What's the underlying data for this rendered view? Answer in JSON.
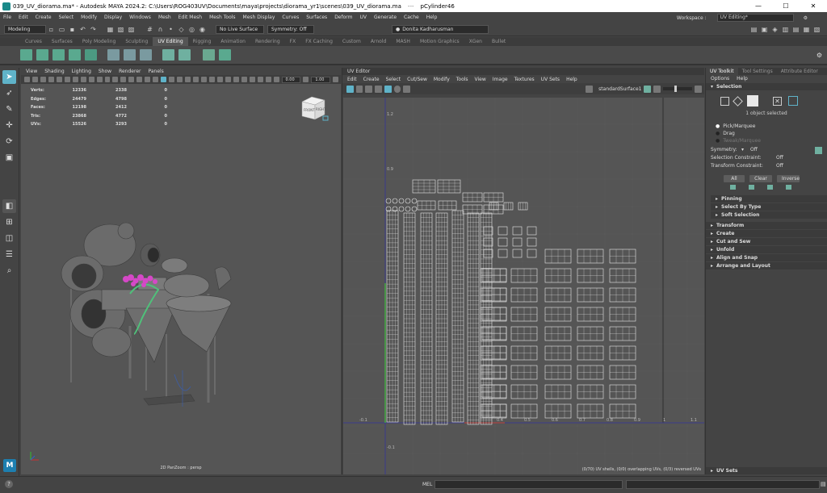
{
  "window": {
    "title": "039_UV_diorama.ma* - Autodesk MAYA 2024.2: C:\\Users\\ROG403UV\\Documents\\maya\\projects\\diorama_yr1\\scenes\\039_UV_diorama.ma",
    "separator": "---",
    "object": "pCylinder46"
  },
  "menubar": [
    "File",
    "Edit",
    "Create",
    "Select",
    "Modify",
    "Display",
    "Windows",
    "Mesh",
    "Edit Mesh",
    "Mesh Tools",
    "Mesh Display",
    "Curves",
    "Surfaces",
    "Deform",
    "UV",
    "Generate",
    "Cache",
    "Help"
  ],
  "workspace": {
    "label": "Workspace :",
    "value": "UV Editing*"
  },
  "status": {
    "mode": "Modeling",
    "live": "No Live Surface",
    "symmetry": "Symmetry: Off",
    "user": "Donita Kadharusman"
  },
  "shelf_tabs": [
    "Curves",
    "Surfaces",
    "Poly Modeling",
    "Sculpting",
    "UV Editing",
    "Rigging",
    "Animation",
    "Rendering",
    "FX",
    "FX Caching",
    "Custom",
    "Arnold",
    "MASH",
    "Motion Graphics",
    "XGen",
    "Bullet"
  ],
  "shelf_active": "UV Editing",
  "viewport": {
    "menu": [
      "View",
      "Shading",
      "Lighting",
      "Show",
      "Renderer",
      "Panels"
    ],
    "exposure": "0.00",
    "gamma": "1.00",
    "hud": [
      {
        "label": "Verts:",
        "a": "12336",
        "b": "2338",
        "c": "0"
      },
      {
        "label": "Edges:",
        "a": "24479",
        "b": "4798",
        "c": "0"
      },
      {
        "label": "Faces:",
        "a": "12198",
        "b": "2412",
        "c": "0"
      },
      {
        "label": "Tris:",
        "a": "23868",
        "b": "4772",
        "c": "0"
      },
      {
        "label": "UVs:",
        "a": "15526",
        "b": "3293",
        "c": "0"
      }
    ],
    "cube": {
      "front": "FRONT",
      "right": "RIGHT"
    },
    "caption": "2D PanZoom : persp"
  },
  "uv_editor": {
    "title": "UV Editor",
    "menu": [
      "Edit",
      "Create",
      "Select",
      "Cut/Sew",
      "Modify",
      "Tools",
      "View",
      "Image",
      "Textures",
      "UV Sets",
      "Help"
    ],
    "shader": "standardSurface1",
    "status": "(0/70) UV shells, (0/0) overlapping UVs, (0/3) reversed UVs",
    "axis_v": [
      "1.2",
      "0.9",
      "-0.1"
    ],
    "axis_u": [
      "-0.1",
      "0.4",
      "0.5",
      "0.6",
      "0.7",
      "0.8",
      "0.9",
      "1",
      "1.1"
    ]
  },
  "toolkit": {
    "tabs": [
      "UV Toolkit",
      "Tool Settings",
      "Attribute Editor"
    ],
    "options": [
      "Options",
      "Help"
    ],
    "selection_header": "Selection",
    "objects_selected": "1 object selected",
    "pick": [
      "Pick/Marquee",
      "Drag",
      "Tweak/Marquee"
    ],
    "symmetry": {
      "label": "Symmetry:",
      "value": "Off"
    },
    "sel_constraint": {
      "label": "Selection Constraint:",
      "value": "Off"
    },
    "xform_constraint": {
      "label": "Transform Constraint:",
      "value": "Off"
    },
    "buttons": [
      "All",
      "Clear",
      "Inverse"
    ],
    "subsections": [
      "Pinning",
      "Select By Type",
      "Soft Selection"
    ],
    "sections": [
      "Transform",
      "Create",
      "Cut and Sew",
      "Unfold",
      "Align and Snap",
      "Arrange and Layout"
    ],
    "uv_sets": "UV Sets"
  },
  "cmd": {
    "lang": "MEL"
  },
  "colors": {
    "accent": "#5fb3c9",
    "uvline": "#e8e8e8",
    "grid": "#5c5c5c"
  }
}
